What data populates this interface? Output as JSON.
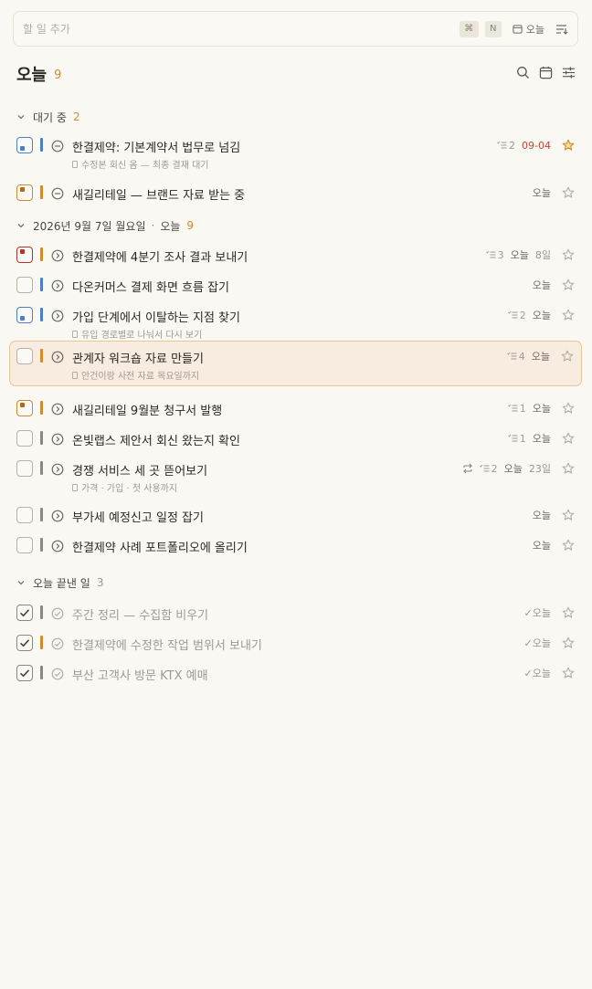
{
  "add_bar": {
    "placeholder": "할 일 추가",
    "cmd_key": "⌘",
    "n_key": "N",
    "date_label": "오늘"
  },
  "header": {
    "title": "오늘",
    "count": "9"
  },
  "sections": {
    "waiting": {
      "label": "대기 중",
      "count": "2"
    },
    "today": {
      "date": "2026년 9월 7일 월요일",
      "label": "오늘",
      "count": "9"
    },
    "done": {
      "label": "오늘 끝낸 일",
      "count": "3"
    }
  },
  "tasks": [
    {
      "title": "한결제약: 기본계약서 법무로 넘김",
      "sub": "수정본 회신 옴 — 최종 결재 대기",
      "subtasks": "2",
      "date": "09-04",
      "star": true,
      "priority": "blue",
      "bar": "#4d7fc4",
      "status": "waiting"
    },
    {
      "title": "새길리테일 — 브랜드 자료 받는 중",
      "sub": "",
      "subtasks": "",
      "date": "오늘",
      "star": false,
      "priority": "orange",
      "bar": "#d28a2e",
      "status": "waiting"
    },
    {
      "title": "한결제약에 4분기 조사 결과 보내기",
      "sub": "",
      "subtasks": "3",
      "date": "오늘",
      "deadline": "8일",
      "star": false,
      "priority": "red",
      "bar": "#d28a2e",
      "status": "next"
    },
    {
      "title": "다온커머스 결제 화면 흐름 잡기",
      "sub": "",
      "subtasks": "",
      "date": "오늘",
      "star": false,
      "priority": "none",
      "bar": "#4d7fc4",
      "status": "next"
    },
    {
      "title": "가입 단계에서 이탈하는 지점 찾기",
      "sub": "유입 경로별로 나눠서 다시 보기",
      "subtasks": "2",
      "date": "오늘",
      "star": false,
      "priority": "blue",
      "bar": "#4d7fc4",
      "status": "next"
    },
    {
      "title": "관계자 워크숍 자료 만들기",
      "sub": "안건이랑 사전 자료 목요일까지",
      "subtasks": "4",
      "date": "오늘",
      "star": false,
      "priority": "none",
      "bar": "#d28a2e",
      "status": "next",
      "highlighted": true
    },
    {
      "title": "새길리테일 9월분 청구서 발행",
      "sub": "",
      "subtasks": "1",
      "date": "오늘",
      "star": false,
      "priority": "orange",
      "bar": "#d28a2e",
      "status": "next"
    },
    {
      "title": "온빛랩스 제안서 회신 왔는지 확인",
      "sub": "",
      "subtasks": "1",
      "date": "오늘",
      "star": false,
      "priority": "none",
      "bar": "#8d887f",
      "status": "next"
    },
    {
      "title": "경쟁 서비스 세 곳 뜯어보기",
      "sub": "가격 · 가입 · 첫 사용까지",
      "subtasks": "2",
      "repeat": true,
      "date": "오늘",
      "deadline": "23일",
      "star": false,
      "priority": "none",
      "bar": "#8d887f",
      "status": "next"
    },
    {
      "title": "부가세 예정신고 일정 잡기",
      "sub": "",
      "subtasks": "",
      "date": "오늘",
      "star": false,
      "priority": "none",
      "bar": "#8d887f",
      "status": "next"
    },
    {
      "title": "한결제약 사례 포트폴리오에 올리기",
      "sub": "",
      "subtasks": "",
      "date": "오늘",
      "star": false,
      "priority": "none",
      "bar": "#8d887f",
      "status": "next"
    },
    {
      "title": "주간 정리 — 수집함 비우기",
      "sub": "",
      "subtasks": "",
      "date": "✓오늘",
      "star": false,
      "priority": "done",
      "bar": "#8d887f",
      "status": "done"
    },
    {
      "title": "한결제약에 수정한 작업 범위서 보내기",
      "sub": "",
      "subtasks": "",
      "date": "✓오늘",
      "star": false,
      "priority": "done",
      "bar": "#d28a2e",
      "status": "done"
    },
    {
      "title": "부산 고객사 방문 KTX 예매",
      "sub": "",
      "subtasks": "",
      "date": "✓오늘",
      "star": false,
      "priority": "done",
      "bar": "#8d887f",
      "status": "done"
    }
  ],
  "colors": {
    "accent": "#d28a2e",
    "blue": "#4d7fc4",
    "red": "#b2352b",
    "overdue": "#c0473a",
    "highlight_bg": "#f8ebe0",
    "highlight_border": "#ecc39a"
  },
  "icons": {
    "search": "search-icon",
    "calendar": "calendar-icon",
    "filter": "filter-icon",
    "sort": "sort-icon",
    "star": "star-icon",
    "repeat": "repeat-icon",
    "subtask": "subtask-icon"
  }
}
